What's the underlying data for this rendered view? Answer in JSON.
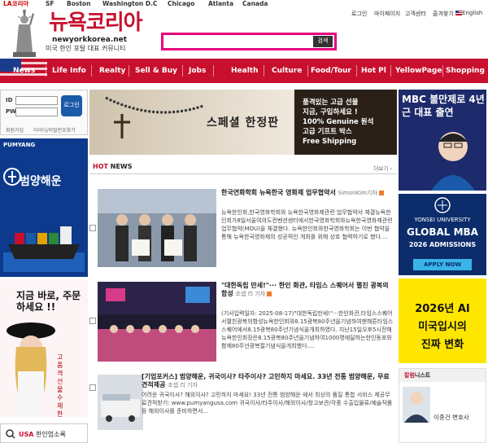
{
  "cities": [
    "LA코리아",
    "SF",
    "Boston",
    "Washington D.C",
    "Chicago",
    "Atlanta",
    "Canada"
  ],
  "header": {
    "logo": "뉴욕코리아",
    "domain": "newyorkkorea.net",
    "tagline": "미국 한인 포탈 대표 커뮤니티",
    "search_button": "검색",
    "search_placeholder": ""
  },
  "util_links": [
    "로그인",
    "마이페이지",
    "고객센터",
    "즐겨찾기",
    "English"
  ],
  "nav": [
    "News",
    "Life Info",
    "Realty",
    "Sell & Buy",
    "Jobs",
    "Health",
    "Culture",
    "Food/Tour",
    "Hot Pl",
    "YellowPage",
    "Shopping"
  ],
  "login": {
    "id_label": "ID",
    "pw_label": "PW",
    "button": "로그인",
    "join": "회원가입",
    "find": "아이디/비밀번호찾기"
  },
  "left_ads": {
    "pumyang_brand": "PUMYANG",
    "pumyang_title": "범양해운",
    "shop_title": "지금 바로, 주문하세요 !!",
    "shop_sub": "고품격선물 수제한과",
    "usa_search": "USA 한인업소록",
    "usa_word": "USA",
    "usa_rest": "한인업소록"
  },
  "banner": {
    "special": "스페셜 한정판",
    "lines": [
      "품격있는 고급 선물",
      "지금, 구입하세요 !",
      "100% Genuine 원석",
      "고급 기프트 박스",
      "Free Shipping"
    ]
  },
  "hot_news": {
    "title_hot": "HOT",
    "title_news": "NEWS",
    "more": "더보기 ›"
  },
  "news": [
    {
      "headline": "한국연화학회 뉴욕한국 영화제 업무협약서",
      "author": "SimonKim기자",
      "body": "뉴욕한인회,한국영화학회와 뉴욕한국영화제관련 업무협약서 체결뉴욕한인회가8일서울여의도컨벤션센터에서한국영화학회와뉴욕한국영화제관련 업무협약(MOU)을 체결했다. 뉴욕한인회와한국영화학회는 이번 협약을 통해 뉴욕한국영화제의 성공적인 개최를 위해 상호 협력하기로 했다...."
    },
    {
      "headline": "\"대한독립 만세!\"··· 한인 화관, 타임스 스퀘어서 펼친 광복의 함성",
      "author": "조셉 리 기자",
      "body": "(기사입력일자: 2025-08-17)\"대한독립만세!\"···한인화관,타임스스퀘어서펼친광복의함성뉴욕한인회와8.15광복80주년을기념하여맨해튼타임스스퀘어에서8.15광복80주년기념식을개최하였다. 지난15일오후5시전해뉴욕한인회장은8.15광복80주년을기념하여1000명에달하는한인동포와함께80주년광복절기념식을개최했다...."
    },
    {
      "headline": "[기업포커스] 범양해운, 귀국이사? 타주이사? 고민하지 마세요. 33년 전통 범양해운, 무료견적제공",
      "author": "조셉 리 기자",
      "body": "어려운 귀국이사? 해외이사? 고민하지 마세요! 33년 전통 범양해운 에서 최상의 품질 통합 서비스 제공무료견적받기: www.pumyangusa.com 귀국이사/타주이사/해외이사/창고보관/각종 수출입물류/예술작품 등 해외이사를 준비하면서..."
    }
  ],
  "right_ads": {
    "mbc": "MBC 불만제로 4년근 대표 출연",
    "yonsei_u": "YONSEI UNIVERSITY",
    "yonsei_g": "GLOBAL MBA",
    "yonsei_y": "2026 ADMISSIONS",
    "yonsei_apply": "APPLY NOW",
    "ai_l1": "2026년 AI",
    "ai_l2": "미국입시의",
    "ai_l3": "진짜 변화",
    "columnist_hd_red": "칼럼",
    "columnist_hd_rest": "니스트",
    "columnist_name": "이종건 변호사"
  },
  "colors": {
    "brand_red": "#c8102e",
    "search_border": "#e6007e",
    "navy": "#0d3a8c"
  }
}
